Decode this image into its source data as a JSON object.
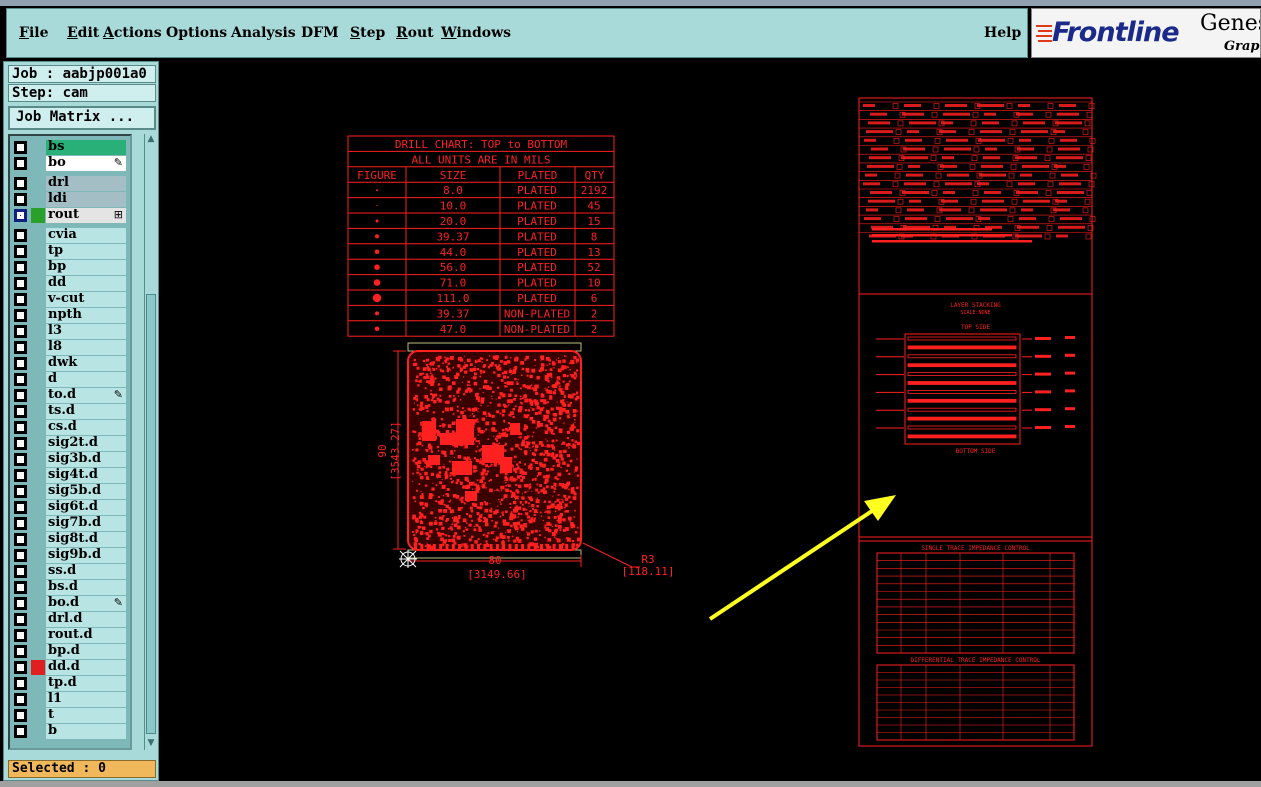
{
  "menubar": {
    "items": [
      {
        "label": "File",
        "underline": "F",
        "rest": "ile"
      },
      {
        "label": "Edit",
        "underline": "E",
        "rest": "dit"
      },
      {
        "label": "Actions",
        "underline": "A",
        "rest": "ctions"
      },
      {
        "label": "Options",
        "underline": "",
        "rest": "Options"
      },
      {
        "label": "Analysis",
        "underline": "",
        "rest": "Analysis"
      },
      {
        "label": "DFM",
        "underline": "",
        "rest": "DFM"
      },
      {
        "label": "Step",
        "underline": "S",
        "rest": "tep"
      },
      {
        "label": "Rout",
        "underline": "R",
        "rest": "out"
      },
      {
        "label": "Windows",
        "underline": "W",
        "rest": "indows"
      }
    ],
    "help": "Help"
  },
  "brand": {
    "logo": "Frontline",
    "product": "Genes",
    "subtitle": "Graph"
  },
  "job": "Job : aabjp001a0",
  "step": "Step: cam",
  "job_matrix": "Job Matrix ...",
  "layers": [
    {
      "name": "bs",
      "state": "sel"
    },
    {
      "name": "bo",
      "state": "aff",
      "mark": "pencil"
    },
    {
      "name": "drl",
      "state": "grey"
    },
    {
      "name": "ldi",
      "state": "grey"
    },
    {
      "name": "rout",
      "state": "lt",
      "mark": "box",
      "color": "#2aa02a",
      "cb": "blue"
    },
    {
      "name": "cvia"
    },
    {
      "name": "tp"
    },
    {
      "name": "bp"
    },
    {
      "name": "dd"
    },
    {
      "name": "v-cut"
    },
    {
      "name": "npth"
    },
    {
      "name": "l3"
    },
    {
      "name": "l8"
    },
    {
      "name": "dwk"
    },
    {
      "name": "d"
    },
    {
      "name": "to.d",
      "mark": "pencil"
    },
    {
      "name": "ts.d"
    },
    {
      "name": "cs.d"
    },
    {
      "name": "sig2t.d"
    },
    {
      "name": "sig3b.d"
    },
    {
      "name": "sig4t.d"
    },
    {
      "name": "sig5b.d"
    },
    {
      "name": "sig6t.d"
    },
    {
      "name": "sig7b.d"
    },
    {
      "name": "sig8t.d"
    },
    {
      "name": "sig9b.d"
    },
    {
      "name": "ss.d"
    },
    {
      "name": "bs.d"
    },
    {
      "name": "bo.d",
      "mark": "pencil"
    },
    {
      "name": "drl.d"
    },
    {
      "name": "rout.d"
    },
    {
      "name": "bp.d"
    },
    {
      "name": "dd.d",
      "color": "#e02020"
    },
    {
      "name": "tp.d"
    },
    {
      "name": "l1"
    },
    {
      "name": "t"
    },
    {
      "name": "b"
    }
  ],
  "selected": "Selected : 0",
  "drill_chart": {
    "title": "DRILL CHART: TOP to BOTTOM",
    "subtitle": "ALL UNITS ARE IN MILS",
    "headers": [
      "FIGURE",
      "SIZE",
      "PLATED",
      "QTY"
    ],
    "rows": [
      {
        "size": "8.0",
        "plated": "PLATED",
        "qty": "2192"
      },
      {
        "size": "10.0",
        "plated": "PLATED",
        "qty": "45"
      },
      {
        "size": "20.0",
        "plated": "PLATED",
        "qty": "15"
      },
      {
        "size": "39.37",
        "plated": "PLATED",
        "qty": "8"
      },
      {
        "size": "44.0",
        "plated": "PLATED",
        "qty": "13"
      },
      {
        "size": "56.0",
        "plated": "PLATED",
        "qty": "52"
      },
      {
        "size": "71.0",
        "plated": "PLATED",
        "qty": "10"
      },
      {
        "size": "111.0",
        "plated": "PLATED",
        "qty": "6"
      },
      {
        "size": "39.37",
        "plated": "NON-PLATED",
        "qty": "2"
      },
      {
        "size": "47.0",
        "plated": "NON-PLATED",
        "qty": "2"
      }
    ]
  },
  "board_dims": {
    "height": "90",
    "height_mils": "[3543.27]",
    "width": "80",
    "width_mils": "[3149.66]",
    "radius": "R3",
    "radius_mils": "[118.11]"
  },
  "spec_sheet": {
    "stackup_title": "LAYER STACKING",
    "stackup_sub": "SCALE:NONE",
    "top_side": "TOP SIDE",
    "bottom_side": "BOTTOM SIDE",
    "single_title": "SINGLE TRACE IMPEDANCE CONTROL",
    "diff_title": "DIFFERENTIAL TRACE IMPEDANCE CONTROL"
  },
  "colors": {
    "panel": "#a8dada",
    "canvas": "#000000",
    "feature": "#ff2020",
    "arrow": "#ffff20"
  }
}
